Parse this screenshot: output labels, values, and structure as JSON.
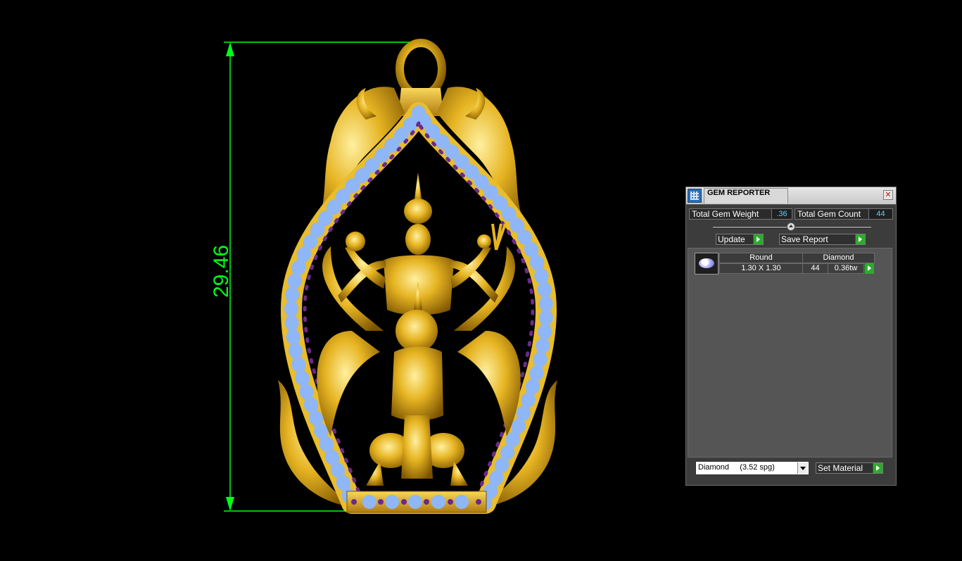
{
  "dimension": {
    "value": "29.46"
  },
  "gem_reporter": {
    "title": "GEM REPORTER",
    "close_symbol": "✕",
    "total_gem_weight_label": "Total Gem Weight",
    "total_gem_weight_value": ".36",
    "total_gem_count_label": "Total Gem Count",
    "total_gem_count_value": "44",
    "update_label": "Update",
    "save_report_label": "Save Report",
    "gems": [
      {
        "shape": "Round",
        "material": "Diamond",
        "size": "1.30 X 1.30",
        "count": "44",
        "weight": "0.36tw"
      }
    ],
    "material_select": {
      "selected": "Diamond     (3.52 spg)"
    },
    "set_material_label": "Set Material"
  },
  "icons": [
    "gem-reporter-icon",
    "close-icon",
    "slider-knob-icon",
    "go-arrow-icon",
    "gem-thumbnail-icon",
    "dropdown-arrow-icon"
  ],
  "colors": {
    "dimension_line": "#00ff19",
    "gold": "#e6b422",
    "gem_blue": "#8fb6f5",
    "gem_purple": "#6a2a8a",
    "value_text": "#57d3ff",
    "go_button": "#2eaa2e"
  }
}
